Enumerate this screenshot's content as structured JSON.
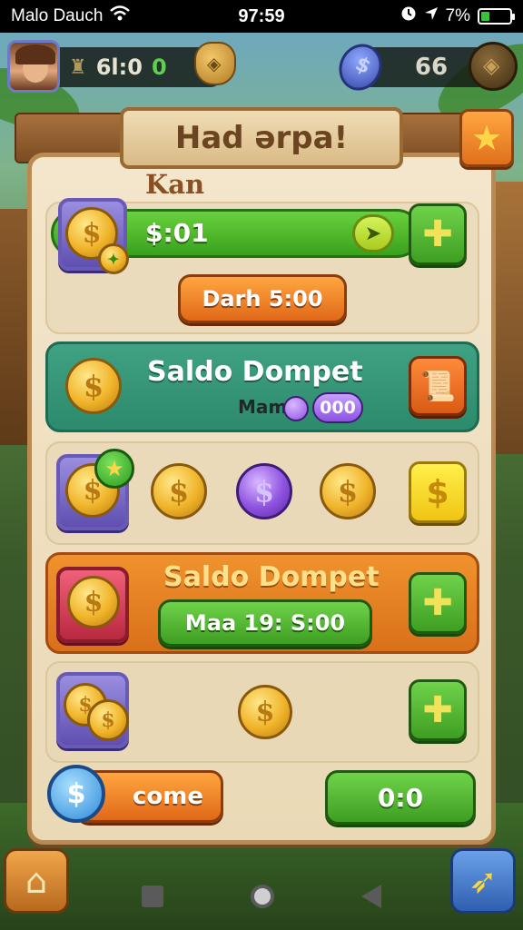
{
  "status_bar": {
    "carrier": "Malo Dauch",
    "time": "97:59",
    "battery": "7%",
    "battery_fill_fraction": 0.3
  },
  "hud": {
    "left_value": "6l:0",
    "left_green_value": "0",
    "right_value": "66"
  },
  "title": "Had ərpa!",
  "sub_label": "Kan",
  "row1": {
    "bar_text": "$:01",
    "button_label": "Darh 5:00"
  },
  "row2": {
    "title": "Saldo Dompet",
    "sub_label": "Mam",
    "badge_value": "000"
  },
  "row4": {
    "title": "Saldo Dompet",
    "button_label": "Maa 19: S:00"
  },
  "row6": {
    "left_button_label": "come",
    "right_button_label": "0:0"
  },
  "colors": {
    "board": "#f3e6cc",
    "teal": "#3fa282",
    "orange": "#f0922e",
    "green": "#3e9e22"
  }
}
